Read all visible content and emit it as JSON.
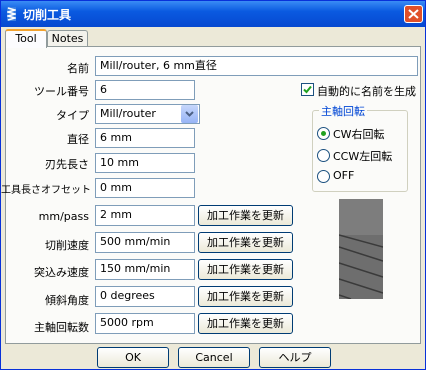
{
  "window": {
    "title": "切削工具",
    "close_glyph": "✕"
  },
  "tabs": [
    {
      "label": "Tool"
    },
    {
      "label": "Notes"
    }
  ],
  "form": {
    "name": {
      "label": "名前",
      "value": "Mill/router, 6 mm直径"
    },
    "tool_number": {
      "label": "ツール番号",
      "value": "6"
    },
    "type": {
      "label": "タイプ",
      "value": "Mill/router"
    },
    "diameter": {
      "label": "直径",
      "value": "6 mm"
    },
    "flute_length": {
      "label": "刃先長さ",
      "value": "10 mm"
    },
    "length_offset": {
      "label": "工具長さオフセット",
      "value": "0 mm"
    },
    "mm_per_pass": {
      "label": "mm/pass",
      "value": "2 mm"
    },
    "cutting_speed": {
      "label": "切削速度",
      "value": "500 mm/min"
    },
    "plunge_speed": {
      "label": "突込み速度",
      "value": "150 mm/min"
    },
    "ramp_angle": {
      "label": "傾斜角度",
      "value": "0 degrees"
    },
    "spindle_speed": {
      "label": "主軸回転数",
      "value": "5000 rpm"
    }
  },
  "update_button_label": "加工作業を更新",
  "auto_name": {
    "label": "自動的に名前を生成",
    "checked": true
  },
  "spindle_group": {
    "title": "主軸回転",
    "options": [
      {
        "label": "CW右回転",
        "selected": true
      },
      {
        "label": "CCW左回転",
        "selected": false
      },
      {
        "label": "OFF",
        "selected": false
      }
    ]
  },
  "buttons": {
    "ok": "OK",
    "cancel": "Cancel",
    "help": "ヘルプ"
  },
  "colors": {
    "titlebar": "#0a5ae0",
    "group_title": "#0046d5",
    "radio_selected": "#21a121"
  }
}
